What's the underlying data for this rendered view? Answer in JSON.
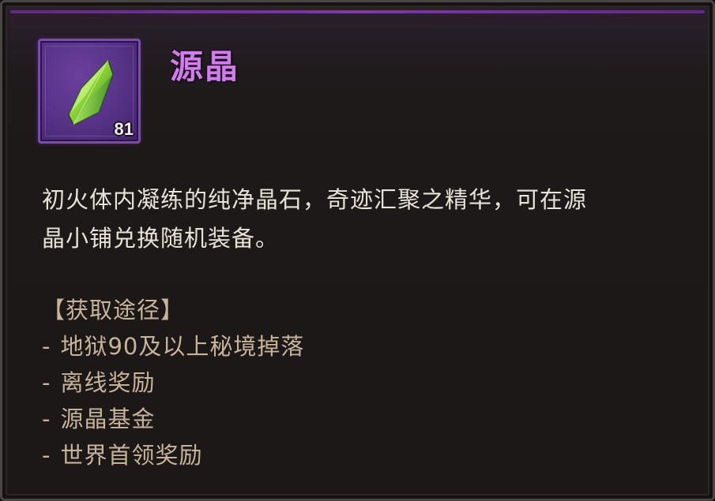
{
  "item": {
    "name": "源晶",
    "count": "81",
    "icon": "green-crystal-icon",
    "colors": {
      "title": "#cf7de8",
      "slot_border": "#7d4bb0",
      "slot_bg": "#573286",
      "description": "#e9e2d8",
      "sources": "#c7b39a"
    }
  },
  "description": {
    "line1": "初火体内凝练的纯净晶石，奇迹汇聚之精华，可在源",
    "line2": "晶小铺兑换随机装备。"
  },
  "sources": {
    "header": "【获取途径】",
    "dash": "-",
    "items": [
      "地狱90及以上秘境掉落",
      "离线奖励",
      "源晶基金",
      "世界首领奖励"
    ]
  }
}
